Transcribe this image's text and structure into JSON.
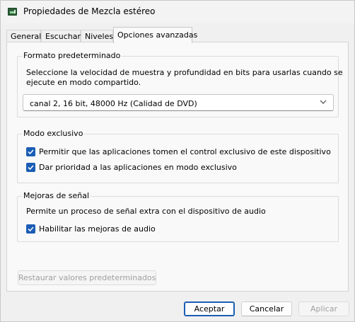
{
  "window": {
    "title": "Propiedades de Mezcla estéreo",
    "icon": "speaker-device-icon"
  },
  "tabs": [
    {
      "label": "General",
      "active": false
    },
    {
      "label": "Escuchar",
      "active": false
    },
    {
      "label": "Niveles",
      "active": false
    },
    {
      "label": "Opciones avanzadas",
      "active": true
    }
  ],
  "format": {
    "title": "Formato predeterminado",
    "description_line1": "Seleccione la velocidad de muestra y profundidad en bits para usarlas cuando se",
    "description_line2": "ejecute en modo compartido.",
    "selected": "canal 2, 16 bit, 48000 Hz (Calidad de DVD)"
  },
  "exclusive": {
    "title": "Modo exclusivo",
    "options": [
      {
        "label": "Permitir que las aplicaciones tomen el control exclusivo de este dispositivo",
        "checked": true
      },
      {
        "label": "Dar prioridad a las aplicaciones en modo exclusivo",
        "checked": true
      }
    ]
  },
  "enhancements": {
    "title": "Mejoras de señal",
    "description": "Permite un proceso de señal extra con el dispositivo de audio",
    "option": {
      "label": "Habilitar las mejoras de audio",
      "checked": true
    }
  },
  "restore_label": "Restaurar valores predeterminados",
  "buttons": {
    "ok": "Aceptar",
    "cancel": "Cancelar",
    "apply": "Aplicar"
  },
  "colors": {
    "accent": "#1b5db5",
    "panel": "#f9f9f9",
    "window": "#f0f0f0"
  }
}
